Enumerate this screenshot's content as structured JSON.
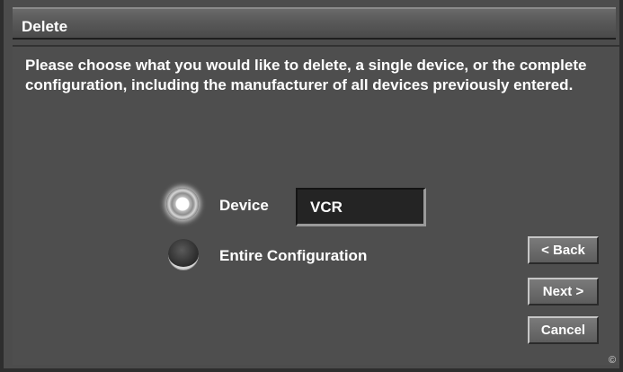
{
  "dialog": {
    "title": "Delete",
    "instructions": "Please choose what you would like to delete, a single device, or the complete configuration, including the manufacturer of all devices previously entered."
  },
  "options": {
    "device": {
      "label": "Device",
      "selected": true
    },
    "entire": {
      "label": "Entire Configuration",
      "selected": false
    }
  },
  "device_field": {
    "value": "VCR"
  },
  "buttons": {
    "back": "< Back",
    "next": "Next >",
    "cancel": "Cancel"
  },
  "footer": {
    "copyright_symbol": "©"
  }
}
